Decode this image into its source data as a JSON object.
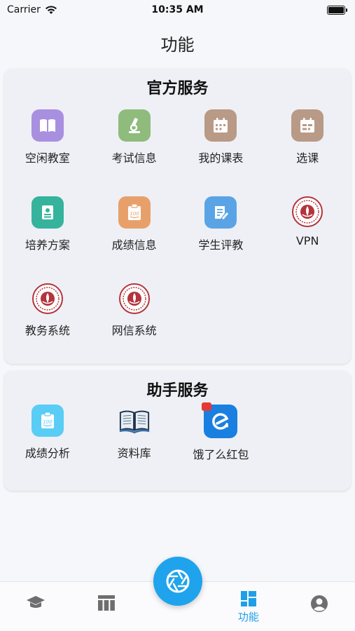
{
  "status": {
    "carrier": "Carrier",
    "time": "10:35 AM"
  },
  "page_title": "功能",
  "official": {
    "title": "官方服务",
    "items": [
      {
        "label": "空闲教室",
        "icon": "book-icon",
        "color": "#a98fe0"
      },
      {
        "label": "考试信息",
        "icon": "microscope-icon",
        "color": "#8fbb7c"
      },
      {
        "label": "我的课表",
        "icon": "calendar-icon",
        "color": "#b89a86"
      },
      {
        "label": "选课",
        "icon": "calendar-select-icon",
        "color": "#b89a86"
      },
      {
        "label": "培养方案",
        "icon": "document-icon",
        "color": "#36b39c"
      },
      {
        "label": "成绩信息",
        "icon": "score-icon",
        "color": "#e8a06a"
      },
      {
        "label": "学生评教",
        "icon": "edit-note-icon",
        "color": "#5aa4e6"
      },
      {
        "label": "VPN",
        "icon": "university-emblem-icon",
        "color": "#b4343c"
      },
      {
        "label": "教务系统",
        "icon": "university-emblem-icon",
        "color": "#b4343c"
      },
      {
        "label": "网信系统",
        "icon": "university-emblem-icon",
        "color": "#b4343c"
      }
    ]
  },
  "assistant": {
    "title": "助手服务",
    "items": [
      {
        "label": "成绩分析",
        "icon": "score-analysis-icon",
        "color": "#59cdf5"
      },
      {
        "label": "资料库",
        "icon": "open-book-icon",
        "color": "#3a6fa8"
      },
      {
        "label": "饿了么红包",
        "icon": "eleme-icon",
        "color": "#1a7fe0"
      }
    ]
  },
  "tabs": [
    {
      "label": "",
      "icon": "graduation-cap-icon"
    },
    {
      "label": "",
      "icon": "timetable-icon"
    },
    {
      "label": "功能",
      "icon": "dashboard-icon",
      "active": true
    },
    {
      "label": "",
      "icon": "profile-icon"
    }
  ],
  "fab": {
    "icon": "camera-aperture-icon"
  }
}
